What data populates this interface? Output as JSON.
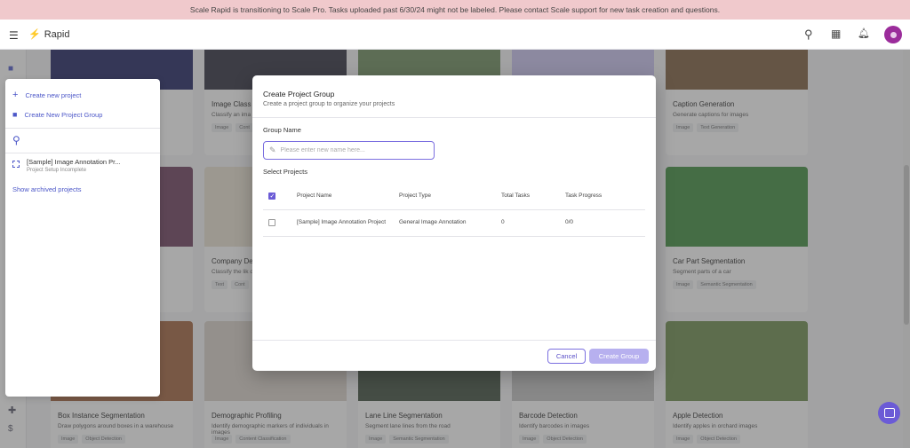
{
  "banner": {
    "text": "Scale Rapid is transitioning to Scale Pro. Tasks uploaded past 6/30/24 might not be labeled. Please contact Scale support for new task creation and questions."
  },
  "topbar": {
    "app_name": "Rapid"
  },
  "sidepanel": {
    "create_project": "Create new project",
    "create_group": "Create New Project Group",
    "project_name": "[Sample] Image Annotation Pr...",
    "project_status": "Project Setup Incomplete",
    "show_archived": "Show archived projects"
  },
  "cards": [
    {
      "title": "",
      "desc": "",
      "tags": [],
      "thumb": "#1b1f5e"
    },
    {
      "title": "Image Class",
      "desc": "Classify an ima",
      "tags": [
        "Image",
        "Cont"
      ],
      "thumb": "#2a2a3a"
    },
    {
      "title": "",
      "desc": "",
      "tags": [],
      "thumb": "#6a8a5a"
    },
    {
      "title": "",
      "desc": "",
      "tags": [],
      "thumb": "#c9c3f0"
    },
    {
      "title": "Caption Generation",
      "desc": "Generate captions for images",
      "tags": [
        "Image",
        "Text Generation"
      ],
      "thumb": "#7a5a3a"
    },
    {
      "title": "",
      "desc": "",
      "tags": [],
      "thumb": "#6a3a5a"
    },
    {
      "title": "Company De",
      "desc": "Classify the lik description",
      "tags": [
        "Text",
        "Cont"
      ],
      "thumb": "#e8e0d0"
    },
    {
      "title": "",
      "desc": "",
      "tags": [],
      "thumb": "#888"
    },
    {
      "title": "",
      "desc": "",
      "tags": [],
      "thumb": "#888"
    },
    {
      "title": "Car Part Segmentation",
      "desc": "Segment parts of a car",
      "tags": [
        "Image",
        "Semantic Segmentation"
      ],
      "thumb": "#3a8a3a"
    },
    {
      "title": "Box Instance Segmentation",
      "desc": "Draw polygons around boxes in a warehouse",
      "tags": [
        "Image",
        "Object Detection"
      ],
      "thumb": "#a0603a"
    },
    {
      "title": "Demographic Profiling",
      "desc": "Identify demographic markers of individuals in images",
      "tags": [
        "Image",
        "Content Classification"
      ],
      "thumb": "#d8d0c8"
    },
    {
      "title": "Lane Line Segmentation",
      "desc": "Segment lane lines from the road",
      "tags": [
        "Image",
        "Semantic Segmentation"
      ],
      "thumb": "#3a4a3a"
    },
    {
      "title": "Barcode Detection",
      "desc": "Identify barcodes in images",
      "tags": [
        "Image",
        "Object Detection"
      ],
      "thumb": "#c0c0c0"
    },
    {
      "title": "Apple Detection",
      "desc": "Identify apples in orchard images",
      "tags": [
        "Image",
        "Object Detection"
      ],
      "thumb": "#6a8a4a"
    }
  ],
  "modal": {
    "title": "Create Project Group",
    "subtitle": "Create a project group to organize your projects",
    "group_name_label": "Group Name",
    "group_name_placeholder": "Please enter new name here...",
    "group_name_value": "",
    "select_projects_label": "Select Projects",
    "columns": [
      "Project Name",
      "Project Type",
      "Total Tasks",
      "Task Progress"
    ],
    "rows": [
      {
        "name": "[Sample] Image Annotation Project",
        "type": "General Image Annotation",
        "total": "0",
        "progress": "0/0",
        "checked": false
      }
    ],
    "header_checked": true,
    "cancel_label": "Cancel",
    "create_label": "Create Group"
  },
  "colors": {
    "accent": "#6b5bd6",
    "banner": "#f0c9cc"
  }
}
